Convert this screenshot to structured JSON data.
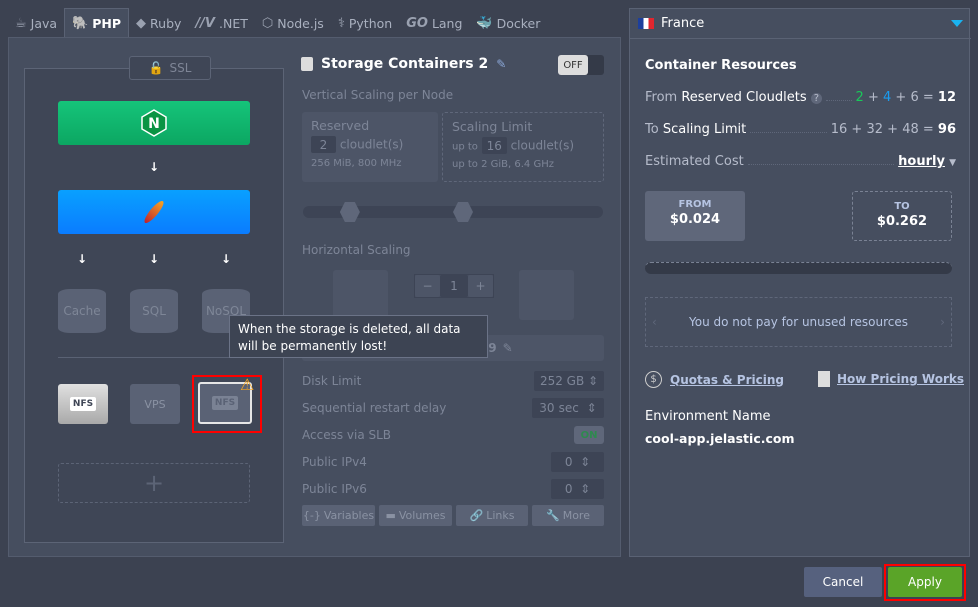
{
  "tabs": [
    {
      "label": "Java",
      "icon": "java-icon"
    },
    {
      "label": "PHP",
      "icon": "php-elephant-icon",
      "active": true
    },
    {
      "label": "Ruby",
      "icon": "ruby-icon"
    },
    {
      "label": ".NET",
      "icon": "dotnet-icon"
    },
    {
      "label": "Node.js",
      "icon": "nodejs-icon"
    },
    {
      "label": "Python",
      "icon": "python-icon"
    },
    {
      "label": "Lang",
      "icon": "go-icon",
      "prefix": "GO"
    },
    {
      "label": "Docker",
      "icon": "docker-icon"
    }
  ],
  "topology": {
    "ssl": "SSL",
    "databases": [
      "Cache",
      "SQL",
      "NoSQL"
    ],
    "storage": [
      "NFS",
      "VPS",
      "NFS"
    ]
  },
  "tooltip": "When the storage is deleted, all data will be permanently lost!",
  "node": {
    "title": "Storage Containers 2",
    "toggle": "OFF",
    "vertical_title": "Vertical Scaling per Node",
    "reserved": {
      "label": "Reserved",
      "value": "2",
      "unit": "cloudlet(s)",
      "spec": "256 MiB, 800 MHz"
    },
    "limit": {
      "label": "Scaling Limit",
      "prefix": "up to",
      "value": "16",
      "unit": "cloudlet(s)",
      "spec": "up to 2 GiB, 6.4 GHz"
    },
    "slider": {
      "min": "0",
      "max": "32",
      "reserved": 2,
      "limit": 16
    },
    "horizontal_title": "Horizontal Scaling",
    "count": "1",
    "minus": "−",
    "plus": "+",
    "nfs": "NFS",
    "version": "0-7.9",
    "disk_limit": {
      "label": "Disk Limit",
      "value": "252 GB"
    },
    "restart_delay": {
      "label": "Sequential restart delay",
      "value": "30",
      "unit": "sec"
    },
    "slb": {
      "label": "Access via SLB",
      "value": "ON"
    },
    "ipv4": {
      "label": "Public IPv4",
      "value": "0"
    },
    "ipv6": {
      "label": "Public IPv6",
      "value": "0"
    },
    "buttons": [
      "Variables",
      "Volumes",
      "Links",
      "More"
    ]
  },
  "region": {
    "name": "France"
  },
  "resources": {
    "title": "Container Resources",
    "reserved": {
      "pre": "From",
      "label": "Reserved Cloudlets",
      "parts": [
        "2",
        "4",
        "6"
      ],
      "total": "12"
    },
    "limit": {
      "pre": "To",
      "label": "Scaling Limit",
      "parts": [
        "16",
        "32",
        "48"
      ],
      "total": "96"
    },
    "cost": {
      "label": "Estimated Cost",
      "period": "hourly"
    },
    "from": {
      "label": "FROM",
      "value": "$0.024"
    },
    "to": {
      "label": "TO",
      "value": "$0.262"
    },
    "note": "You do not pay for unused resources",
    "quotas": "Quotas & Pricing",
    "how": "How Pricing Works",
    "env_label": "Environment Name",
    "env_name": "cool-app.jelastic.com",
    "colors": {
      "nginx": "#11b36b",
      "apache": "#0a8fff",
      "apply": "#5aa428",
      "cancel": "#56617e",
      "highlight": "#ff0000"
    }
  },
  "footer": {
    "cancel": "Cancel",
    "apply": "Apply"
  }
}
